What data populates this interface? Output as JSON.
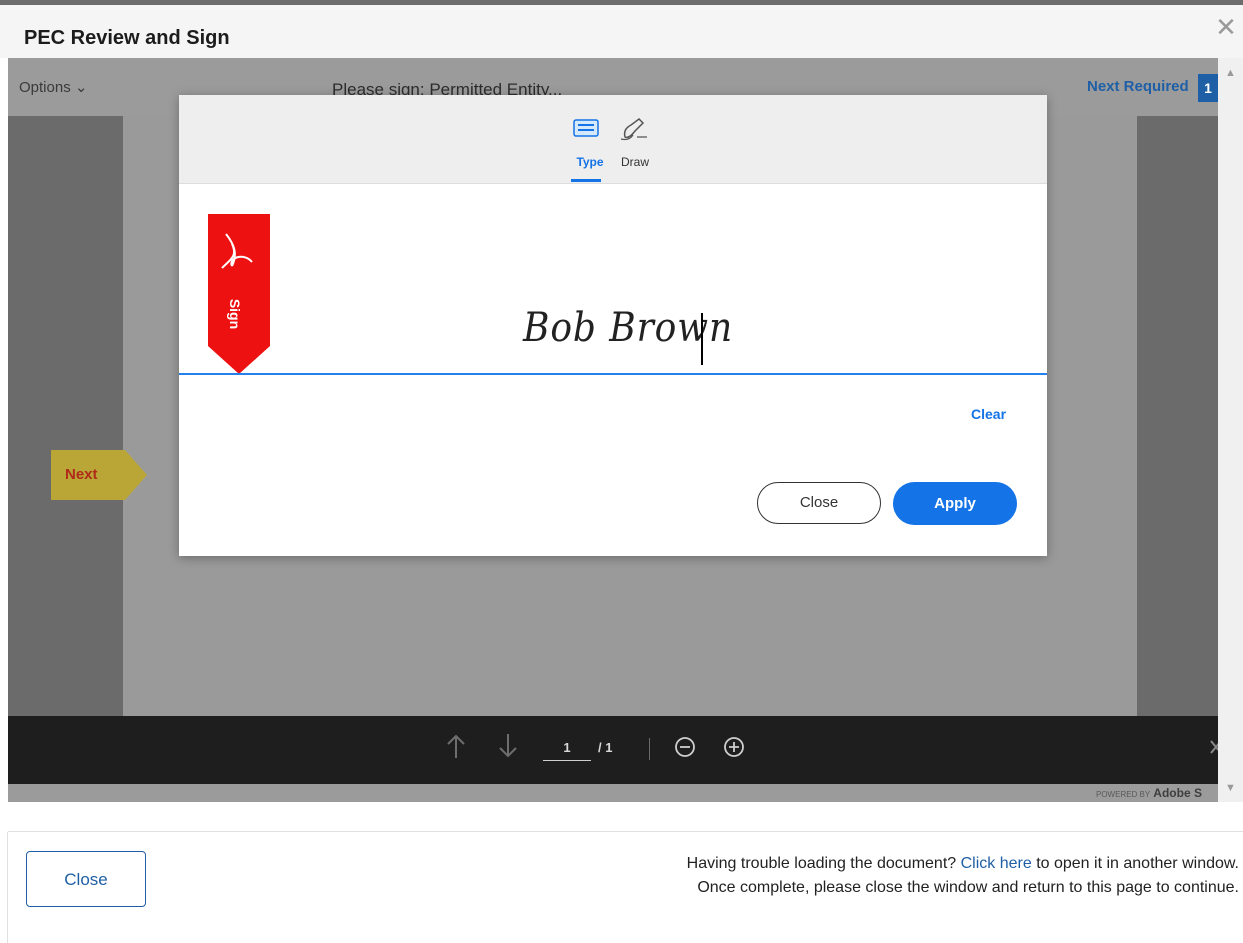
{
  "modal": {
    "title": "PEC Review and Sign",
    "close_icon": "✕"
  },
  "viewer": {
    "options_label": "Options ⌄",
    "doc_title": "Please sign: Permitted Entity...",
    "next_required_label": "Next Required",
    "required_count": "1",
    "next_tag_label": "Next",
    "page_number": "1",
    "page_total": "/ 1",
    "powered_prefix": "POWERED BY",
    "powered_brand": "Adobe S",
    "icons": {
      "prev_page": "arrow-up-icon",
      "next_page": "arrow-down-icon",
      "zoom_out": "zoom-out-icon",
      "zoom_in": "zoom-in-icon",
      "close_bar": "close-icon"
    }
  },
  "signature_dialog": {
    "tabs": [
      {
        "label": "Type",
        "icon": "keyboard-icon",
        "active": true
      },
      {
        "label": "Draw",
        "icon": "pen-icon",
        "active": false
      }
    ],
    "sign_flag_label": "Sign",
    "signature_text": "Bob Brown",
    "clear_label": "Clear",
    "close_label": "Close",
    "apply_label": "Apply"
  },
  "footer": {
    "close_label": "Close",
    "help_prefix": "Having trouble loading the document? ",
    "help_link": "Click here",
    "help_suffix": " to open it in another window.",
    "help_line2": "Once complete, please close the window and return to this page to continue."
  },
  "colors": {
    "accent": "#1473e6",
    "link": "#1f5fa6",
    "flag_red": "#ee1111",
    "next_tag": "#b9a636"
  }
}
